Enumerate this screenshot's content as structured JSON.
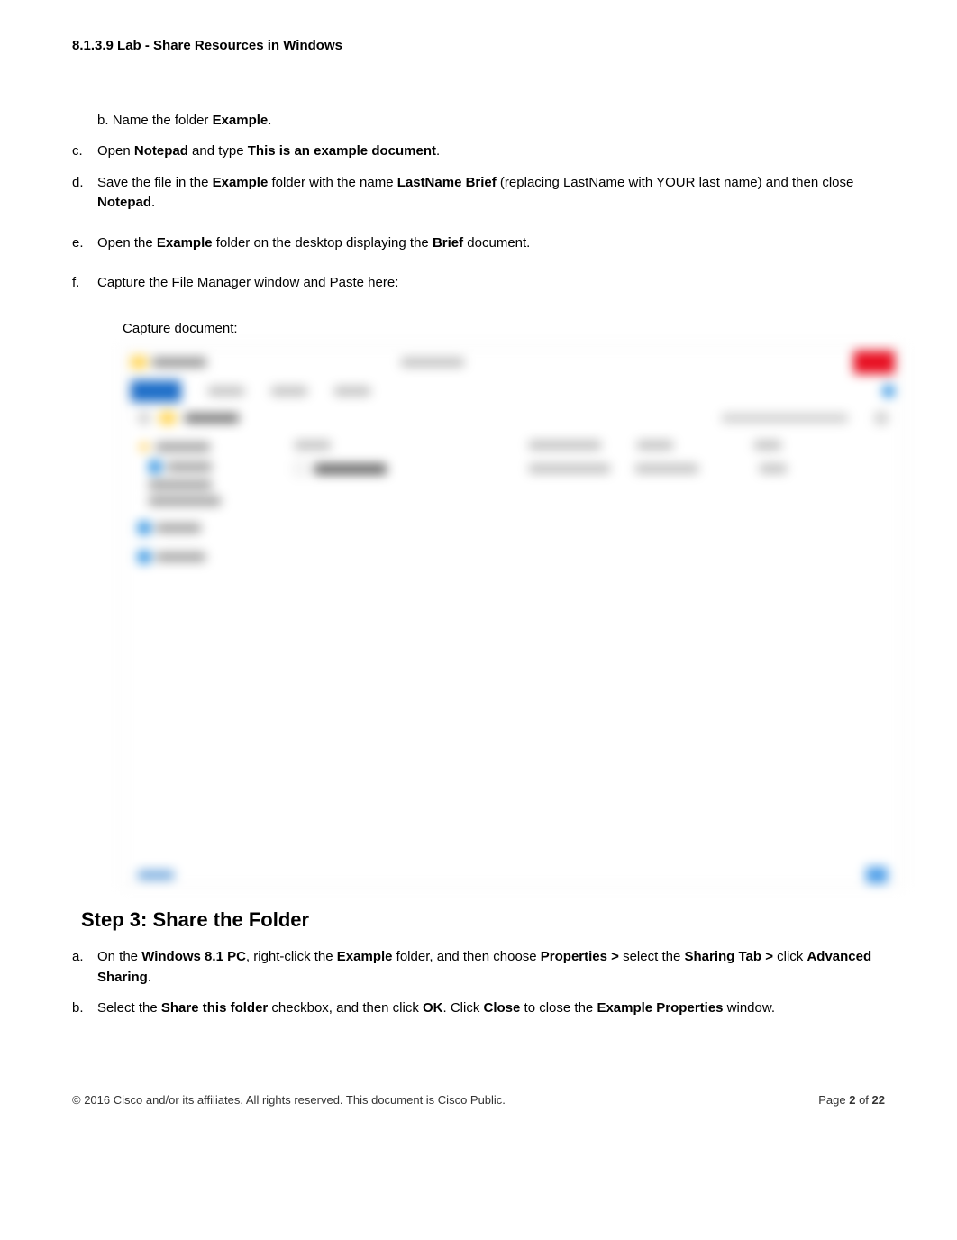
{
  "title": "8.1.3.9 Lab - Share Resources in Windows",
  "items": {
    "b1_marker": "b.",
    "b1_pre": "Name the folder ",
    "b1_bold": "Example",
    "b1_post": ".",
    "c_marker": "c.",
    "c_pre": "Open ",
    "c_b1": "Notepad",
    "c_mid": " and type ",
    "c_b2": "This is an example document",
    "c_post": ".",
    "d_marker": "d.",
    "d_pre": "Save the file in the ",
    "d_b1": "Example",
    "d_mid1": " folder with the name ",
    "d_b2": "LastName Brief",
    "d_mid2": " (replacing LastName with YOUR last name) and then close ",
    "d_b3": "Notepad",
    "d_post": ".",
    "e_marker": "e.",
    "e_pre": "Open the ",
    "e_b1": "Example",
    "e_mid": " folder on the desktop displaying the ",
    "e_b2": "Brief",
    "e_post": " document.",
    "f_marker": "f.",
    "f_text": "Capture the File Manager window and Paste here:",
    "capture_label": "Capture document:"
  },
  "step3": {
    "heading": "Step 3: Share the Folder",
    "a_marker": "a.",
    "a_pre": "On the ",
    "a_b1": "Windows 8.1 PC",
    "a_mid1": ", right-click the ",
    "a_b2": "Example",
    "a_mid2": " folder, and then choose ",
    "a_b3": "Properties >",
    "a_mid3": " select the ",
    "a_b4": "Sharing Tab >",
    "a_mid4": " click ",
    "a_b5": "Advanced Sharing",
    "a_post": ".",
    "b_marker": "b.",
    "b_pre": "Select the ",
    "b_b1": "Share this folder",
    "b_mid1": " checkbox, and then click ",
    "b_b2": "OK",
    "b_mid2": ". Click ",
    "b_b3": "Close",
    "b_mid3": " to close the ",
    "b_b4": "Example Properties",
    "b_post": " window."
  },
  "footer": {
    "copyright": "© 2016 Cisco and/or its affiliates. All rights reserved. This document is Cisco Public.",
    "page_pre": "Page ",
    "page_cur": "2",
    "page_mid": " of ",
    "page_total": "22"
  }
}
